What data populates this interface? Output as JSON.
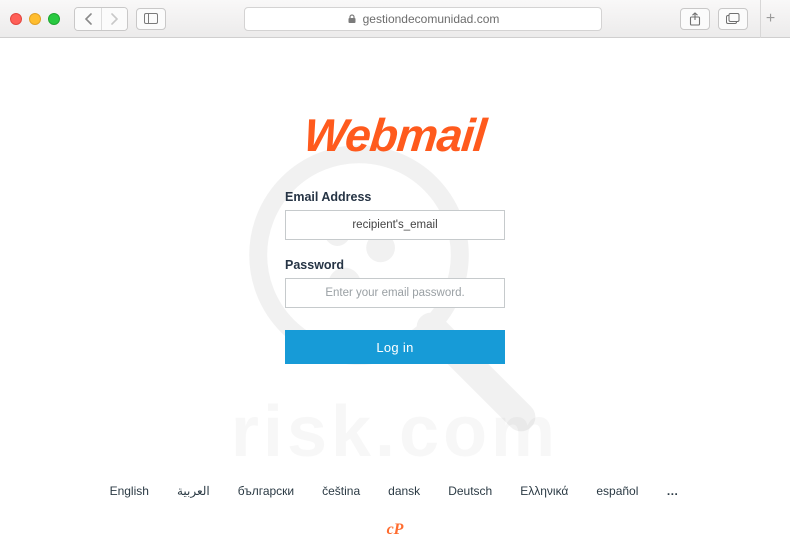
{
  "browser": {
    "url": "gestiondecomunidad.com"
  },
  "logo_text": "Webmail",
  "form": {
    "email_label": "Email Address",
    "email_value": "recipient's_email",
    "password_label": "Password",
    "password_placeholder": "Enter your email password.",
    "login_button": "Log in"
  },
  "languages": [
    "English",
    "العربية",
    "български",
    "čeština",
    "dansk",
    "Deutsch",
    "Ελληνικά",
    "español"
  ],
  "languages_more": "…",
  "watermark_risk": "risk.com",
  "footer_logo": "cP"
}
